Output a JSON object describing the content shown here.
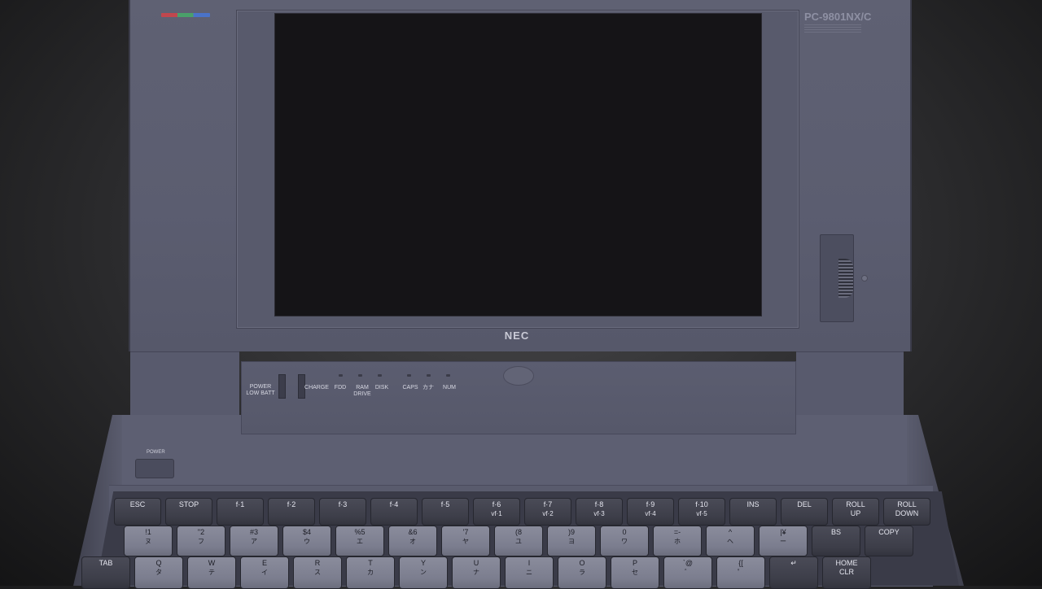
{
  "lid": {
    "model_label": "PC-9801NX/C",
    "brand": "NEC"
  },
  "indicators": {
    "power_low_batt": "POWER\nLOW BATT",
    "charge": "CHARGE",
    "fdd": "FDD",
    "ram_drive": "RAM\nDRIVE",
    "disk": "DISK",
    "caps": "CAPS",
    "kana": "カナ",
    "num": "NUM"
  },
  "power_button_label": "POWER",
  "keyboard": {
    "row_function": [
      {
        "label": "ESC",
        "sub": ""
      },
      {
        "label": "STOP",
        "sub": ""
      },
      {
        "label": "f·1",
        "sub": ""
      },
      {
        "label": "f·2",
        "sub": ""
      },
      {
        "label": "f·3",
        "sub": ""
      },
      {
        "label": "f·4",
        "sub": ""
      },
      {
        "label": "f·5",
        "sub": ""
      },
      {
        "label": "f·6",
        "sub": "vf·1"
      },
      {
        "label": "f·7",
        "sub": "vf·2"
      },
      {
        "label": "f·8",
        "sub": "vf·3"
      },
      {
        "label": "f·9",
        "sub": "vf·4"
      },
      {
        "label": "f·10",
        "sub": "vf·5"
      },
      {
        "label": "INS",
        "sub": ""
      },
      {
        "label": "DEL",
        "sub": ""
      },
      {
        "label": "ROLL\nUP",
        "sub": ""
      },
      {
        "label": "ROLL\nDOWN",
        "sub": ""
      }
    ],
    "row_number": [
      {
        "label": "!1",
        "sub": "ヌ"
      },
      {
        "label": "\"2",
        "sub": "フ"
      },
      {
        "label": "#3",
        "sub": "ア"
      },
      {
        "label": "$4",
        "sub": "ウ"
      },
      {
        "label": "%5",
        "sub": "エ"
      },
      {
        "label": "&6",
        "sub": "オ"
      },
      {
        "label": "'7",
        "sub": "ヤ"
      },
      {
        "label": "(8",
        "sub": "ユ"
      },
      {
        "label": ")9",
        "sub": "ヨ"
      },
      {
        "label": "0",
        "sub": "ワ"
      },
      {
        "label": "=-",
        "sub": "ホ"
      },
      {
        "label": "^",
        "sub": "ヘ"
      },
      {
        "label": "|¥",
        "sub": "ー"
      },
      {
        "label": "BS",
        "sub": ""
      },
      {
        "label": "COPY",
        "sub": ""
      }
    ],
    "row_q": [
      {
        "label": "TAB",
        "sub": ""
      },
      {
        "label": "Q",
        "sub": "タ"
      },
      {
        "label": "W",
        "sub": "テ"
      },
      {
        "label": "E",
        "sub": "イ"
      },
      {
        "label": "R",
        "sub": "ス"
      },
      {
        "label": "T",
        "sub": "カ"
      },
      {
        "label": "Y",
        "sub": "ン"
      },
      {
        "label": "U",
        "sub": "ナ"
      },
      {
        "label": "I",
        "sub": "ニ"
      },
      {
        "label": "O",
        "sub": "ラ"
      },
      {
        "label": "P",
        "sub": "セ"
      },
      {
        "label": "`@",
        "sub": "゛"
      },
      {
        "label": "{[",
        "sub": "゜"
      },
      {
        "label": "↵",
        "sub": ""
      },
      {
        "label": "HOME\nCLR",
        "sub": ""
      }
    ]
  }
}
